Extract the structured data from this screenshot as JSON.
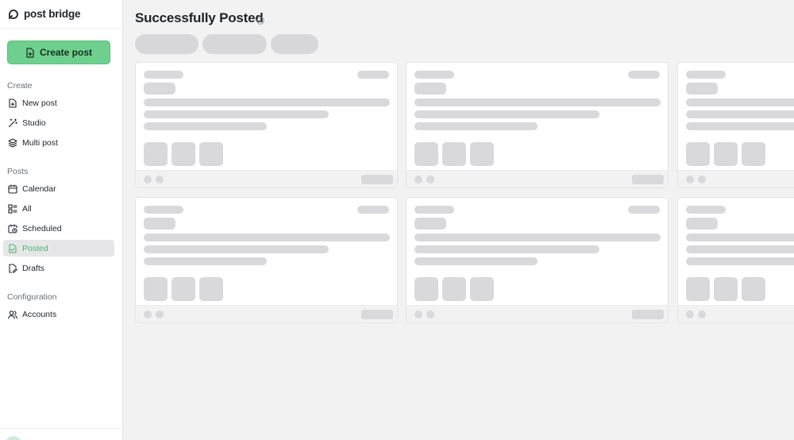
{
  "brand": {
    "name": "post bridge"
  },
  "sidebar": {
    "create_button": "Create post",
    "sections": {
      "create": "Create",
      "posts": "Posts",
      "configuration": "Configuration"
    },
    "items": {
      "new_post": "New post",
      "studio": "Studio",
      "multi_post": "Multi post",
      "calendar": "Calendar",
      "all": "All",
      "scheduled": "Scheduled",
      "posted": "Posted",
      "drafts": "Drafts",
      "accounts": "Accounts"
    },
    "active_item": "Posted"
  },
  "main": {
    "title": "Successfully Posted",
    "loading": true
  },
  "colors": {
    "accent": "#6fcf8e",
    "active_text": "#4cb56f",
    "skeleton": "#d9d9db"
  },
  "icons": [
    "logo-icon",
    "file-plus-icon",
    "wand-icon",
    "layers-icon",
    "calendar-icon",
    "grid-list-icon",
    "calendar-clock-icon",
    "file-check-icon",
    "file-edit-icon",
    "users-icon",
    "info-icon"
  ]
}
